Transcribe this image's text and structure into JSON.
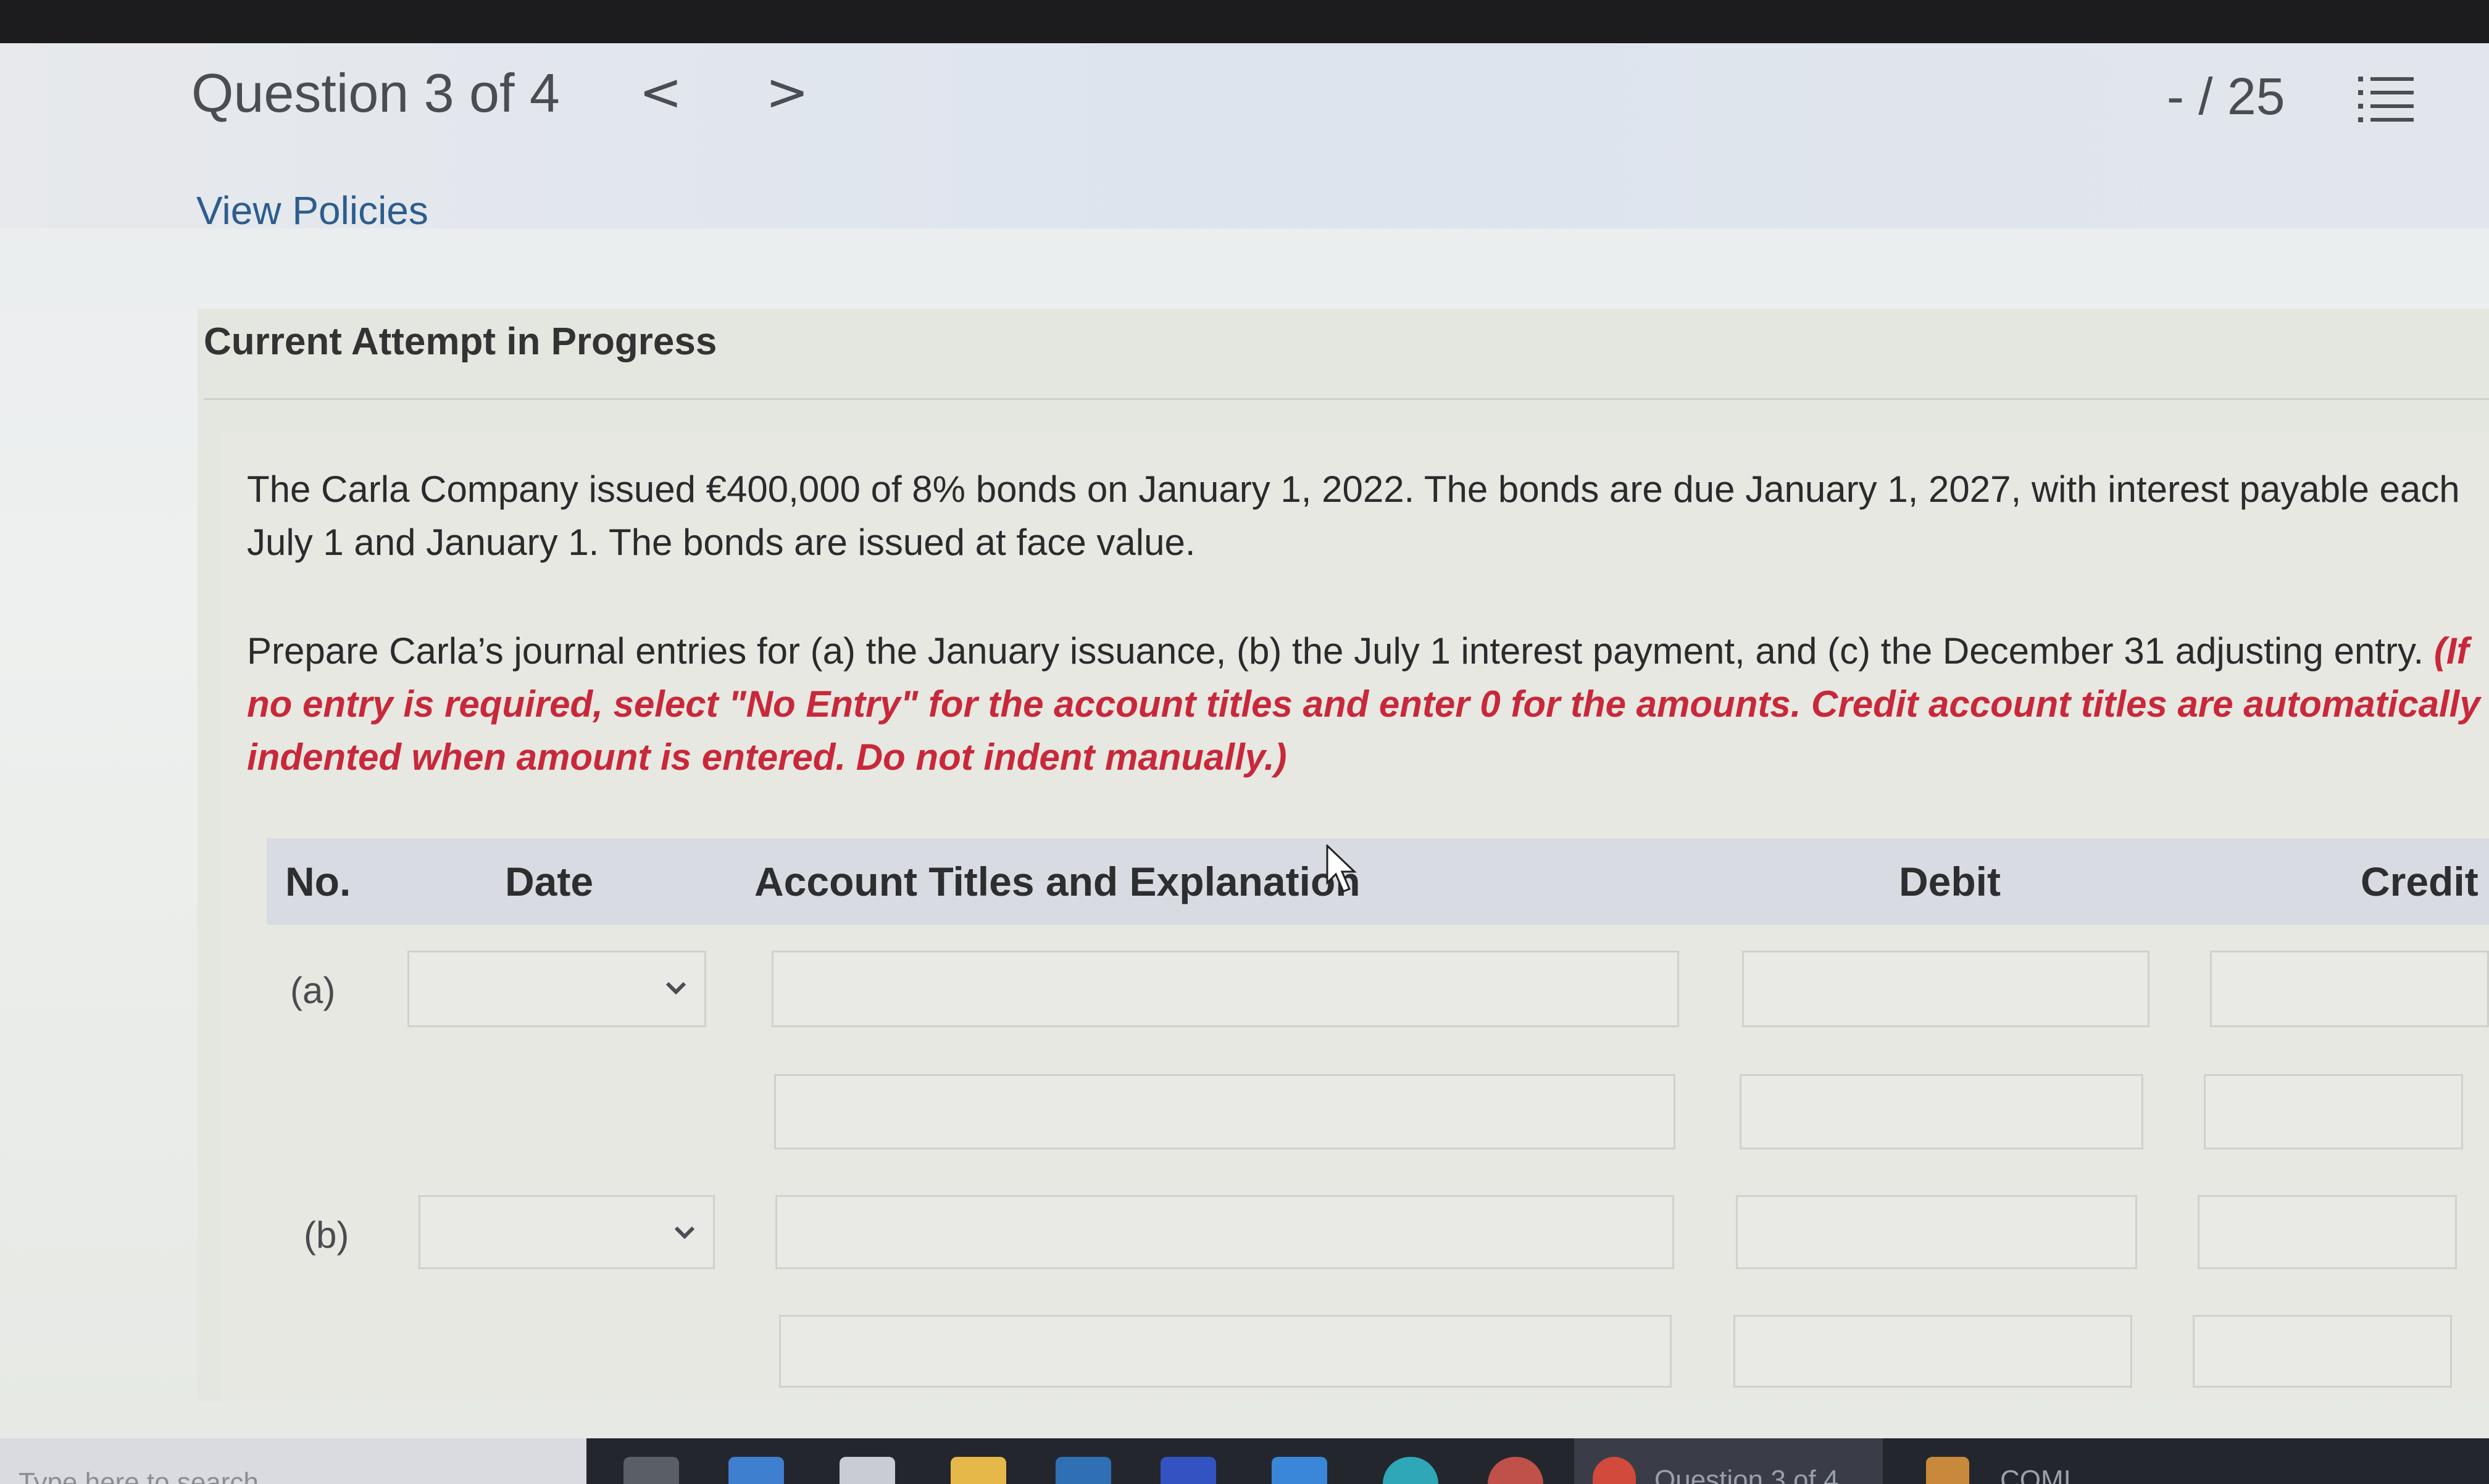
{
  "header": {
    "question_title": "Question 3 of 4",
    "prev_symbol": "<",
    "next_symbol": ">",
    "score": "- / 25"
  },
  "links": {
    "view_policies": "View Policies"
  },
  "attempt_label": "Current Attempt in Progress",
  "question": {
    "intro": "The Carla Company issued €400,000 of 8% bonds on January 1, 2022. The bonds are due January 1, 2027, with interest payable each July 1 and January 1. The bonds are issued at face value.",
    "prompt": "Prepare Carla’s journal entries for (a) the January issuance, (b) the July 1 interest payment, and (c) the December 31 adjusting entry.",
    "instructions": "(If no entry is required, select \"No Entry\" for the account titles and enter 0 for the amounts. Credit account titles are automatically indented when amount is entered. Do not indent manually.)"
  },
  "journal_table": {
    "headers": {
      "no": "No.",
      "date": "Date",
      "account": "Account Titles and Explanation",
      "debit": "Debit",
      "credit": "Credit"
    },
    "rows": [
      {
        "no": "(a)",
        "date": "",
        "account_lines": [
          "",
          ""
        ],
        "debit_lines": [
          "",
          ""
        ],
        "credit_lines": [
          "",
          ""
        ]
      },
      {
        "no": "(b)",
        "date": "",
        "account_lines": [
          "",
          ""
        ],
        "debit_lines": [
          "",
          ""
        ],
        "credit_lines": [
          "",
          ""
        ]
      }
    ]
  },
  "taskbar": {
    "search_placeholder": "Type here to search",
    "active_window": "Question 3 of 4",
    "other_window": "COMI"
  },
  "colors": {
    "instruction_red": "#c8283a",
    "link_blue": "#2c5d8e",
    "header_band": "#d8dce2"
  }
}
